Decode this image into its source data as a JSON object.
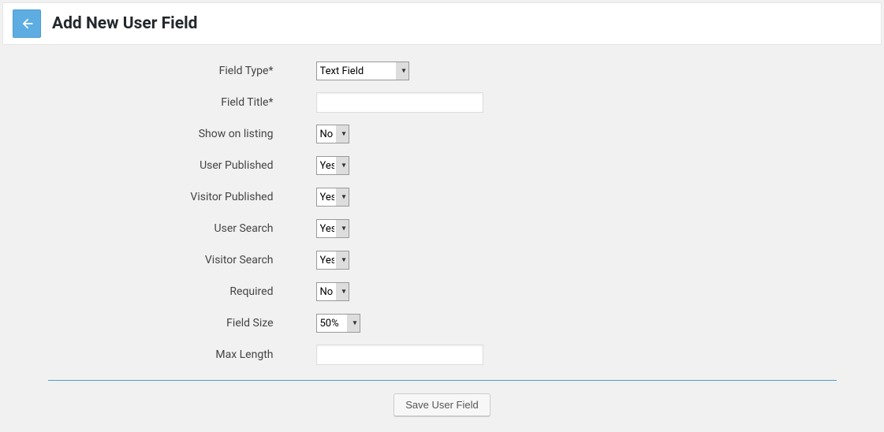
{
  "header": {
    "title": "Add New User Field"
  },
  "form": {
    "fields": {
      "field_type": {
        "label": "Field Type*",
        "value": "Text Field"
      },
      "field_title": {
        "label": "Field Title*",
        "value": ""
      },
      "show_on_listing": {
        "label": "Show on listing",
        "value": "No"
      },
      "user_published": {
        "label": "User Published",
        "value": "Yes"
      },
      "visitor_published": {
        "label": "Visitor Published",
        "value": "Yes"
      },
      "user_search": {
        "label": "User Search",
        "value": "Yes"
      },
      "visitor_search": {
        "label": "Visitor Search",
        "value": "Yes"
      },
      "required": {
        "label": "Required",
        "value": "No"
      },
      "field_size": {
        "label": "Field Size",
        "value": "50%"
      },
      "max_length": {
        "label": "Max Length",
        "value": ""
      }
    },
    "save_label": "Save User Field"
  }
}
